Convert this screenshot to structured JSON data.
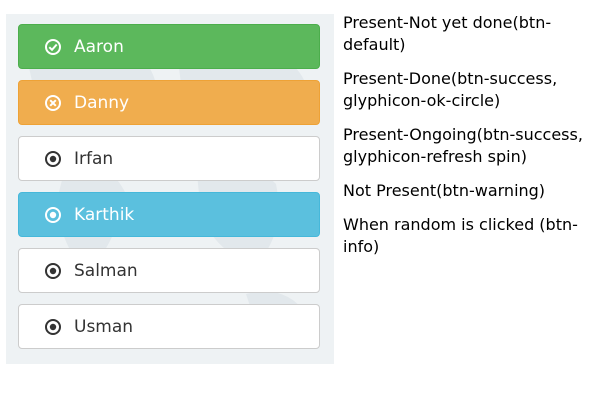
{
  "students": [
    {
      "name": "Aaron",
      "style": "btn-success",
      "icon": "ok-circle-icon"
    },
    {
      "name": "Danny",
      "style": "btn-warning",
      "icon": "remove-circle-icon"
    },
    {
      "name": "Irfan",
      "style": "btn-default",
      "icon": "record-icon"
    },
    {
      "name": "Karthik",
      "style": "btn-info",
      "icon": "record-icon"
    },
    {
      "name": "Salman",
      "style": "btn-default",
      "icon": "record-icon"
    },
    {
      "name": "Usman",
      "style": "btn-default",
      "icon": "record-icon"
    }
  ],
  "legend": [
    "Present-Not yet done(btn-default)",
    "Present-Done(btn-success, glyphicon-ok-circle)",
    "Present-Ongoing(btn-success, glyphicon-refresh spin)",
    "Not Present(btn-warning)",
    "When random is clicked (btn-info)"
  ],
  "colors": {
    "success": "#5cb85c",
    "warning": "#f0ad4e",
    "info": "#5bc0de",
    "default_text": "#333333"
  }
}
